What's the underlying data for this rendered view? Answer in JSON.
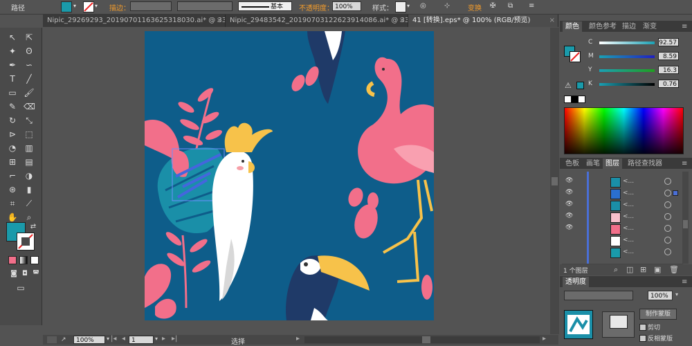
{
  "control_bar": {
    "selection_label": "路径",
    "stroke_label": "描边：",
    "stroke_profile": "基本",
    "opacity_label": "不透明度：",
    "opacity_value": "100%",
    "style_label": "样式：",
    "transform_label": "变换"
  },
  "tabs": [
    {
      "label": "Nipic_29269293_20190701163625318030.ai* @ 33...",
      "active": false
    },
    {
      "label": "Nipic_29483542_20190703122623914086.ai* @ 33...",
      "active": false
    },
    {
      "label": "41 [转换].eps* @ 100% (RGB/预览)",
      "active": true
    }
  ],
  "color_panel": {
    "tabs": [
      "颜色",
      "颜色参考",
      "描边",
      "渐变"
    ],
    "channels": [
      {
        "label": "C",
        "value": "92.57",
        "color": "#1aa0b4"
      },
      {
        "label": "M",
        "value": "8.59",
        "color": "#2020c0"
      },
      {
        "label": "Y",
        "value": "16.3",
        "color": "#20a020"
      },
      {
        "label": "K",
        "value": "0.76",
        "color": "#000000"
      }
    ],
    "fill_color": "#1a9aaa"
  },
  "layers_panel": {
    "tabs": [
      "色板",
      "画笔",
      "图层",
      "路径查找器"
    ],
    "row_label": "<...",
    "footer_count": "1 个图层"
  },
  "bottom_panel": {
    "tab": "透明度",
    "value": "100%",
    "make_mask": "制作蒙版",
    "clip": "剪切",
    "invert_mask": "反相蒙版"
  },
  "status_bar": {
    "zoom": "100%",
    "page": "1",
    "tool_status": "选择"
  },
  "colors": {
    "artboard_bg": "#0e5d8a",
    "accent": "#1a9aaa",
    "flamingo": "#f26f8a",
    "toucan_beak": "#f7c24a"
  }
}
